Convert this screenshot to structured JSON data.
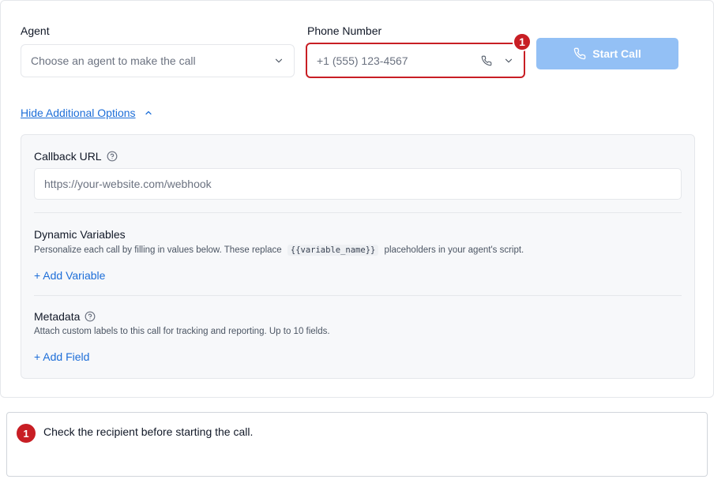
{
  "form": {
    "agent_label": "Agent",
    "agent_placeholder": "Choose an agent to make the call",
    "phone_label": "Phone Number",
    "phone_placeholder": "+1 (555) 123-4567",
    "start_call_label": "Start Call",
    "annotation_badge": "1"
  },
  "options": {
    "toggle_label": "Hide Additional Options",
    "callback": {
      "title": "Callback URL",
      "placeholder": "https://your-website.com/webhook"
    },
    "dynamic_variables": {
      "title": "Dynamic Variables",
      "desc_before": "Personalize each call by filling in values below. These replace",
      "code": "{{variable_name}}",
      "desc_after": "placeholders in your agent's script.",
      "add_label": "+ Add Variable"
    },
    "metadata": {
      "title": "Metadata",
      "desc": "Attach custom labels to this call for tracking and reporting. Up to 10 fields.",
      "add_label": "+ Add Field"
    }
  },
  "note": {
    "badge": "1",
    "text": "Check the recipient before starting the call."
  },
  "colors": {
    "accent": "#1d6ed8",
    "button_disabled": "#93c0f5",
    "annotation": "#c81e24"
  },
  "icons": {
    "chevron": "chevron-down-icon",
    "phone": "phone-icon",
    "help": "help-circle-icon",
    "collapse": "chevron-up-icon"
  }
}
